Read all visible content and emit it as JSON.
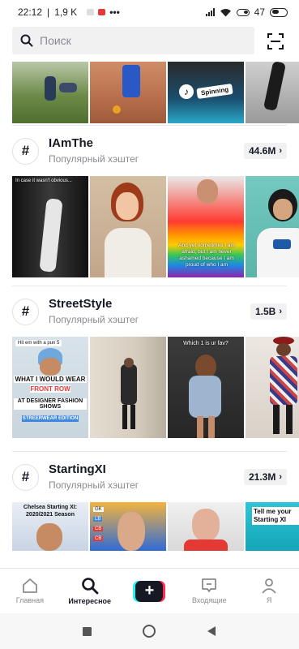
{
  "status": {
    "time": "22:12",
    "speed": "1,9 K",
    "battery": "47"
  },
  "search": {
    "placeholder": "Поиск"
  },
  "hashtags": [
    {
      "name": "IAmThe",
      "subtitle": "Популярный хэштег",
      "count": "44.6M"
    },
    {
      "name": "StreetStyle",
      "subtitle": "Популярный хэштег",
      "count": "1.5B"
    },
    {
      "name": "StartingXI",
      "subtitle": "Популярный хэштег",
      "count": "21.3M"
    }
  ],
  "overlays": {
    "top_spinning": "Spinning",
    "iamthe_1": "In case it wasn't obvious... ",
    "iamthe_3": "And yet sometimes I am afraid, but I am never ashamed because I am proud of who I am",
    "street_1a": "Hit em with a pun 5",
    "street_1b": "WHAT I WOULD WEAR",
    "street_1c": "FRONT ROW",
    "street_1d": "AT DESIGNER FASHION SHOWS",
    "street_1e": "STREERWEAR EDITION",
    "street_3": "Which 1 is ur fav?",
    "xi_1": "Chelsea Starting XI: 2020/2021 Season",
    "xi_2_gk": "GK",
    "xi_2_lb": "LB",
    "xi_2_cb1": "CB",
    "xi_2_cb2": "CB",
    "xi_4": "Tell me your Starting XI"
  },
  "nav": {
    "home": "Главная",
    "discover": "Интересное",
    "inbox": "Входящие",
    "me": "Я"
  },
  "colors": {
    "accent_red": "#fe2c55",
    "accent_cyan": "#25f4ee",
    "text_primary": "#161823",
    "text_secondary": "#8a8b91"
  }
}
